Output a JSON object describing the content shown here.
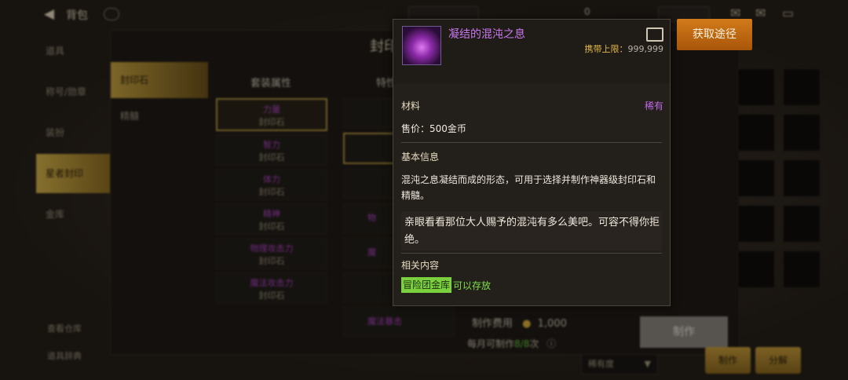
{
  "topbar": {
    "back_glyph": "◀",
    "title": "背包",
    "currency_value": "0"
  },
  "left_nav": {
    "items": [
      "道具",
      "称号/勋章",
      "装扮",
      "星者封印",
      "金库"
    ],
    "active_index": 3
  },
  "bottom_links": [
    "查看仓库",
    "道具辞典"
  ],
  "craft_panel": {
    "title": "封印",
    "sub_tabs": [
      "封印石",
      "精髓"
    ],
    "set_header": "套装属性",
    "feature_header": "特性",
    "set_items": [
      {
        "name": "力量",
        "sub": "封印石"
      },
      {
        "name": "智力",
        "sub": "封印石"
      },
      {
        "name": "体力",
        "sub": "封印石"
      },
      {
        "name": "精神",
        "sub": "封印石"
      },
      {
        "name": "物理攻击力",
        "sub": "封印石"
      },
      {
        "name": "魔法攻击力",
        "sub": "封印石"
      }
    ],
    "feature_items": [
      "",
      "",
      "",
      "物",
      "魔",
      "",
      "魔法暴击"
    ],
    "cost_label": "制作费用",
    "cost_value": "1,000",
    "monthly_label": "每月可制作",
    "monthly_count": "8/8",
    "monthly_unit": "次",
    "craft_button": "制作",
    "rarity_select": "稀有度",
    "bottom_buttons": [
      "制作",
      "分解"
    ]
  },
  "tooltip": {
    "item_name": "凝结的混沌之息",
    "carry_label": "携带上限：",
    "carry_value": "999,999",
    "category": "材料",
    "rarity": "稀有",
    "price": "售价：500金币",
    "basic_info_title": "基本信息",
    "description": "混沌之息凝结而成的形态，可用于选择并制作神器级封印石和精髓。",
    "flavor": "亲眼看看那位大人赐予的混沌有多么美吧。可容不得你拒绝。",
    "related_title": "相关内容",
    "tag": "冒险团金库",
    "tag_note": "可以存放"
  },
  "get_route_button": "获取途径",
  "colors": {
    "accent_gold": "#c99d3a",
    "rare_purple": "#c978ee",
    "green_tag": "#7bd13d",
    "orange_button": "#d27a1a"
  }
}
